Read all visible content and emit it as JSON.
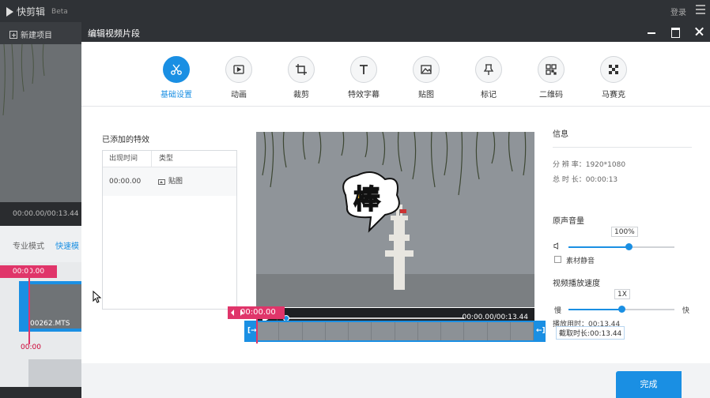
{
  "app": {
    "title": "快剪辑",
    "beta": "Beta",
    "login": "登录",
    "new_project": "新建项目",
    "preview_time": "00:00.00/00:13.44",
    "mode_pro": "专业模式",
    "mode_quick": "快速模",
    "timeline_marker": "00:00.00",
    "clip_name": "00262.MTS",
    "timeline_time": "00:00"
  },
  "modal": {
    "title": "编辑视频片段",
    "tools": [
      {
        "label": "基础设置",
        "icon": "scissors-icon",
        "active": true
      },
      {
        "label": "动画",
        "icon": "animation-icon",
        "active": false
      },
      {
        "label": "裁剪",
        "icon": "crop-icon",
        "active": false
      },
      {
        "label": "特效字幕",
        "icon": "text-icon",
        "active": false
      },
      {
        "label": "贴图",
        "icon": "image-icon",
        "active": false
      },
      {
        "label": "标记",
        "icon": "pin-icon",
        "active": false
      },
      {
        "label": "二维码",
        "icon": "qrcode-icon",
        "active": false
      },
      {
        "label": "马赛克",
        "icon": "mosaic-icon",
        "active": false
      }
    ],
    "effects": {
      "title": "已添加的特效",
      "col_time": "出现时间",
      "col_type": "类型",
      "rows": [
        {
          "time": "00:00.00",
          "type": "贴图"
        }
      ]
    },
    "video": {
      "time": "00:00.00/00:13.44",
      "sticker_text": "棒"
    },
    "info": {
      "title": "信息",
      "resolution_label": "分 辨 率：",
      "resolution": "1920*1080",
      "duration_label": "总 时 长：",
      "duration": "00:00:13",
      "volume_title": "原声音量",
      "volume_value": "100%",
      "volume_level": 0.57,
      "mute_label": "素材静音",
      "speed_title": "视频播放速度",
      "speed_value": "1X",
      "speed_level": 0.5,
      "slow": "慢",
      "fast": "快",
      "playtime": "播放用时：00:13.44"
    },
    "timeline": {
      "marker": "00:00.00",
      "clip_duration": "截取时长:00:13.44",
      "frame_count": 12
    },
    "done": "完成"
  }
}
